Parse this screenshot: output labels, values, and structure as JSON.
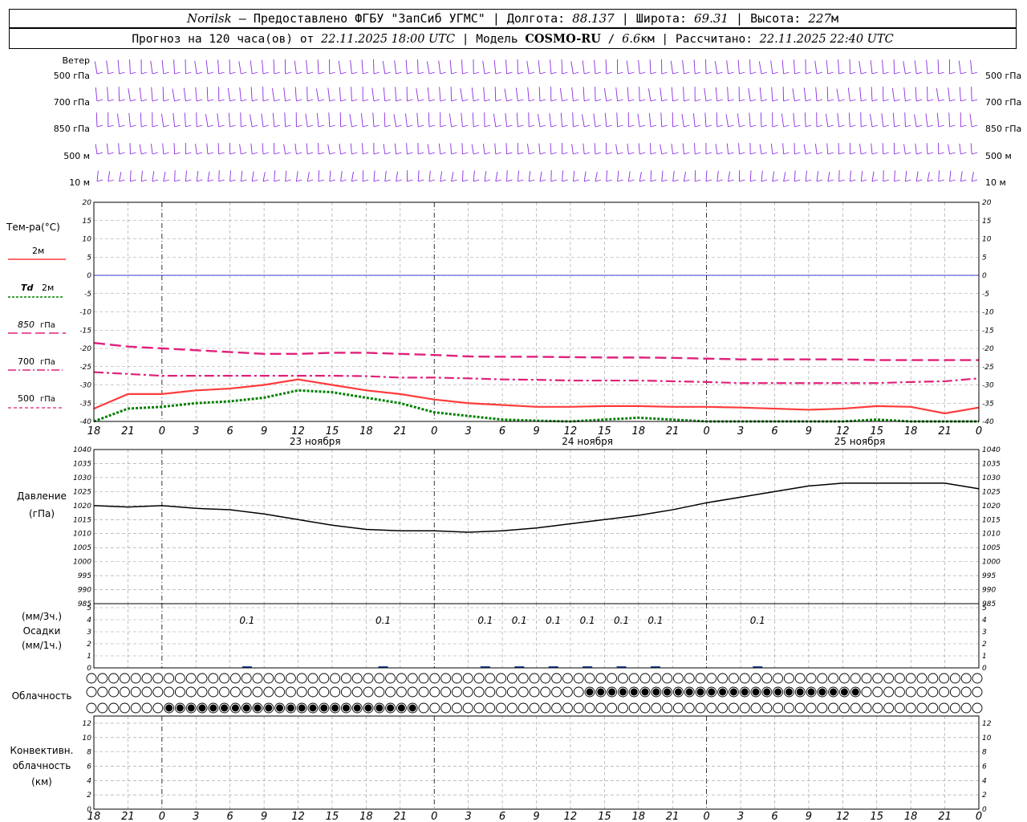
{
  "header": {
    "station": "Norilsk",
    "dash": "–",
    "provider": "Предоставлено ФГБУ \"ЗапСиб УГМС\"",
    "lon_label": "Долгота:",
    "lon": "88.137",
    "lat_label": "Широта:",
    "lat": "69.31",
    "alt_label": "Высота:",
    "alt": "227",
    "alt_unit": "м",
    "forecast_label": "Прогноз на 120 часа(ов) от",
    "forecast_start": "22.11.2025 18:00 UTC",
    "model_label": "Модель",
    "model": "COSMO-RU",
    "resolution": "6.6",
    "res_unit": "км",
    "calc_label": "Рассчитано:",
    "calc_time": "22.11.2025 22:40 UTC"
  },
  "labels": {
    "wind": "Ветер",
    "levels": [
      "500 гПа",
      "700 гПа",
      "850 гПа",
      "500 м",
      "10  м"
    ],
    "temp_title": "Тем-ра(°C)",
    "legend_2m": "2м",
    "legend_td": "Td",
    "legend_td2": "2м",
    "legend_850": "850",
    "legend_700": "700",
    "legend_500": "500",
    "legend_gpa": "гПа",
    "pressure_title": "Давление",
    "pressure_unit": "(гПа)",
    "precip_3h": "(мм/3ч.)",
    "precip_title": "Осадки",
    "precip_1h": "(мм/1ч.)",
    "cloud_title": "Облачность",
    "conv_1": "Конвективн.",
    "conv_2": "облачность",
    "conv_3": "(км)"
  },
  "colors": {
    "wind": "#8a2be2",
    "temp2m": "#ff3b3b",
    "td2m": "#008000",
    "t850": "#e0207a",
    "t700": "#e0207a",
    "t500": "#e0207a",
    "pressure": "#000000",
    "zero_line": "#0000cc",
    "grid": "#9a9a9a"
  },
  "chart_data": {
    "x_hours": [
      18,
      21,
      0,
      3,
      6,
      9,
      12,
      15,
      18,
      21,
      0,
      3,
      6,
      9,
      12,
      15,
      18,
      21,
      0,
      3,
      6,
      9,
      12,
      15,
      18,
      21,
      0
    ],
    "day_labels": [
      {
        "index": 6.5,
        "label": "23 ноября"
      },
      {
        "index": 14.5,
        "label": "24 ноября"
      },
      {
        "index": 22.5,
        "label": "25 ноября"
      }
    ],
    "temperature": {
      "type": "line",
      "ylim": [
        -40,
        20
      ],
      "ticks": [
        20,
        15,
        10,
        5,
        0,
        -5,
        -10,
        -15,
        -20,
        -25,
        -30,
        -35,
        -40
      ],
      "series": [
        {
          "name": "2м",
          "values": [
            -36.5,
            -32.5,
            -32.5,
            -31.5,
            -31,
            -30,
            -28.5,
            -30,
            -31.5,
            -32.5,
            -34,
            -35,
            -35.5,
            -36,
            -36,
            -35.8,
            -35.8,
            -36,
            -36,
            -36.2,
            -36.5,
            -36.8,
            -36.5,
            -35.8,
            -36,
            -37.8,
            -36.2
          ]
        },
        {
          "name": "Td 2м",
          "values": [
            -40,
            -36.5,
            -36,
            -35,
            -34.5,
            -33.5,
            -31.5,
            -32,
            -33.5,
            -35,
            -37.5,
            -38.5,
            -39.5,
            -39.8,
            -40,
            -39.5,
            -39,
            -39.5,
            -40,
            -40.5,
            -41,
            -41,
            -40,
            -39.5,
            -40,
            -41,
            -41
          ]
        },
        {
          "name": "850 гПа",
          "values": [
            -18.5,
            -19.5,
            -20,
            -20.5,
            -21,
            -21.5,
            -21.5,
            -21.2,
            -21.2,
            -21.5,
            -21.8,
            -22.2,
            -22.3,
            -22.3,
            -22.4,
            -22.5,
            -22.5,
            -22.6,
            -22.8,
            -23,
            -23,
            -23,
            -23,
            -23.2,
            -23.2,
            -23.2,
            -23.2
          ]
        },
        {
          "name": "700 гПа",
          "values": [
            -26.5,
            -27,
            -27.5,
            -27.5,
            -27.5,
            -27.5,
            -27.5,
            -27.5,
            -27.6,
            -28,
            -28,
            -28.2,
            -28.5,
            -28.6,
            -28.8,
            -28.8,
            -28.8,
            -29,
            -29.2,
            -29.5,
            -29.5,
            -29.5,
            -29.5,
            -29.5,
            -29.2,
            -29,
            -28.2
          ]
        }
      ]
    },
    "pressure": {
      "type": "line",
      "ylim": [
        985,
        1040
      ],
      "ticks": [
        1040,
        1035,
        1030,
        1025,
        1020,
        1015,
        1010,
        1005,
        1000,
        995,
        990,
        985
      ],
      "values": [
        1020,
        1019.5,
        1020,
        1019,
        1018.5,
        1017,
        1015,
        1013,
        1011.5,
        1011,
        1011,
        1010.5,
        1011,
        1012,
        1013.5,
        1015,
        1016.5,
        1018.5,
        1021,
        1023,
        1025,
        1027,
        1028,
        1028,
        1028,
        1028,
        1026
      ]
    },
    "precipitation": {
      "type": "bar",
      "ylim": [
        0,
        5
      ],
      "ticks": [
        5,
        4,
        3,
        2,
        1,
        0
      ],
      "labels": [
        {
          "index": 4.5,
          "value": "0.1"
        },
        {
          "index": 8.5,
          "value": "0.1"
        },
        {
          "index": 11.5,
          "value": "0.1"
        },
        {
          "index": 12.5,
          "value": "0.1"
        },
        {
          "index": 13.5,
          "value": "0.1"
        },
        {
          "index": 14.5,
          "value": "0.1"
        },
        {
          "index": 15.5,
          "value": "0.1"
        },
        {
          "index": 16.5,
          "value": "0.1"
        },
        {
          "index": 19.5,
          "value": "0.1"
        }
      ]
    },
    "convective": {
      "type": "line",
      "ylim": [
        0,
        13
      ],
      "ticks": [
        12,
        10,
        8,
        6,
        4,
        2,
        0
      ]
    }
  }
}
